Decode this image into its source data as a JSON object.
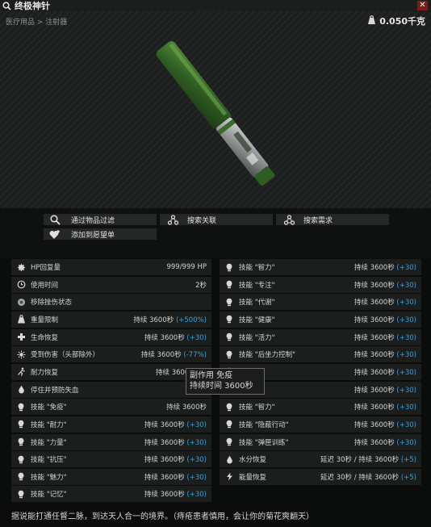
{
  "window": {
    "title": "终极神针",
    "close_label": "✕"
  },
  "breadcrumb": "医疗用品 > 注射器",
  "weight": "0.050千克",
  "actions": [
    {
      "label": "通过物品过滤",
      "icon": "magnifier-icon"
    },
    {
      "label": "搜索关联",
      "icon": "link-nodes-icon"
    },
    {
      "label": "搜索需求",
      "icon": "nodes-search-icon"
    },
    {
      "label": "添加到愿望单",
      "icon": "heart-plus-icon"
    }
  ],
  "stats_left": [
    {
      "icon": "gear-icon",
      "label": "HP回复量",
      "value": "999/999 HP",
      "value_color": ""
    },
    {
      "icon": "clock-icon",
      "label": "使用时间",
      "value": "2秒",
      "value_color": ""
    },
    {
      "icon": "bandage-icon",
      "label": "移除挫伤状态",
      "value": "",
      "value_color": ""
    },
    {
      "icon": "weight-icon",
      "label": "重量限制",
      "value": "持续 3600秒 (+500%)",
      "value_color": "mixed"
    },
    {
      "icon": "cross-icon",
      "label": "生命恢复",
      "value": "持续 3600秒 (+30)",
      "value_color": "mixed"
    },
    {
      "icon": "burst-icon",
      "label": "受到伤害（头部除外）",
      "value": "持续 3600秒 (-77%)",
      "value_color": "mixed"
    },
    {
      "icon": "run-icon",
      "label": "耐力恢复",
      "value": "持续 3600秒 (+",
      "value_color": "mixed"
    },
    {
      "icon": "drop-icon",
      "label": "停住并预防失血",
      "value": "持续 3",
      "value_color": ""
    },
    {
      "icon": "bulb-icon",
      "label": "技能 \"免疫\"",
      "value": "持续 3600秒",
      "value_color": ""
    },
    {
      "icon": "bulb-icon",
      "label": "技能 \"耐力\"",
      "value": "持续 3600秒 (+30)",
      "value_color": "mixed"
    },
    {
      "icon": "bulb-icon",
      "label": "技能 \"力量\"",
      "value": "持续 3600秒 (+30)",
      "value_color": "mixed"
    },
    {
      "icon": "bulb-icon",
      "label": "技能 \"抗压\"",
      "value": "持续 3600秒 (+30)",
      "value_color": "mixed"
    },
    {
      "icon": "bulb-icon",
      "label": "技能 \"魅力\"",
      "value": "持续 3600秒 (+30)",
      "value_color": "mixed"
    },
    {
      "icon": "bulb-icon",
      "label": "技能 \"记忆\"",
      "value": "持续 3600秒 (+30)",
      "value_color": "mixed"
    }
  ],
  "stats_right": [
    {
      "icon": "bulb-icon",
      "label": "技能 \"智力\"",
      "value": "持续 3600秒 (+30)"
    },
    {
      "icon": "bulb-icon",
      "label": "技能 \"专注\"",
      "value": "持续 3600秒 (+30)"
    },
    {
      "icon": "bulb-icon",
      "label": "技能 \"代谢\"",
      "value": "持续 3600秒 (+30)"
    },
    {
      "icon": "bulb-icon",
      "label": "技能 \"健康\"",
      "value": "持续 3600秒 (+30)"
    },
    {
      "icon": "bulb-icon",
      "label": "技能 \"活力\"",
      "value": "持续 3600秒 (+30)"
    },
    {
      "icon": "bulb-icon",
      "label": "技能 \"后坐力控制\"",
      "value": "持续 3600秒 (+30)"
    },
    {
      "icon": "bulb-icon",
      "label": "技能 \"",
      "value": "持续 3600秒 (+30)"
    },
    {
      "icon": "bulb-icon",
      "label": "技能 \"",
      "value": "持续 3600秒 (+30)"
    },
    {
      "icon": "bulb-icon",
      "label": "技能 \"智力\"",
      "value": "持续 3600秒 (+30)"
    },
    {
      "icon": "bulb-icon",
      "label": "技能 \"隐蔽行动\"",
      "value": "持续 3600秒 (+30)"
    },
    {
      "icon": "bulb-icon",
      "label": "技能 \"弹匣训练\"",
      "value": "持续 3600秒 (+30)"
    },
    {
      "icon": "water-icon",
      "label": "水分恢复",
      "value": "延迟 30秒 / 持续 3600秒 (+5)"
    },
    {
      "icon": "bolt-icon",
      "label": "能量恢复",
      "value": "延迟 30秒 / 持续 3600秒 (+5)"
    }
  ],
  "tooltip": {
    "line1": "副作用 免疫",
    "line2": "持续时间 3600秒"
  },
  "description": "据说能打通任督二脉，到达天人合一的境界。（痔疮患者慎用，会让你的菊花爽翻天）",
  "colors": {
    "accent_blue": "#3aa0d8",
    "close_red": "#7d1c15"
  }
}
